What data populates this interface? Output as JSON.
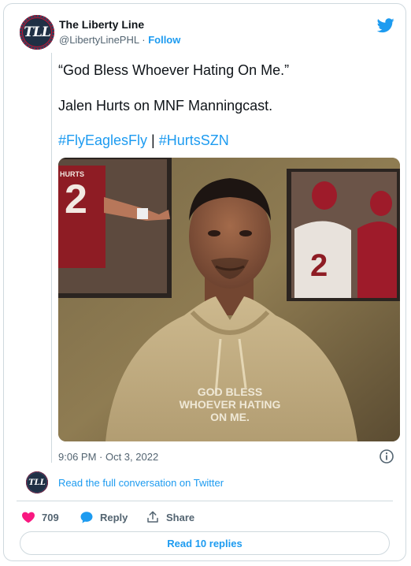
{
  "author": {
    "name": "The Liberty Line",
    "handle": "@LibertyLinePHL",
    "separator": "·",
    "follow_label": "Follow",
    "avatar_text": "TLL",
    "avatar_icon": "liberty-line-logo-icon"
  },
  "tweet": {
    "line1": "“God Bless Whoever Hating On Me.”",
    "line2": "Jalen Hurts on MNF Manningcast.",
    "hashtag1": "#FlyEaglesFly",
    "hashtag_separator": " | ",
    "hashtag2": "#HurtsSZN"
  },
  "media": {
    "hoodie_text": [
      "GOD BLESS",
      "WHOEVER HATING",
      "ON ME."
    ],
    "jersey_number": "2",
    "poster_label": "HURTS"
  },
  "meta": {
    "datetime": "9:06 PM · Oct 3, 2022"
  },
  "conversation": {
    "link_label": "Read the full conversation on Twitter"
  },
  "actions": {
    "like_count": "709",
    "reply_label": "Reply",
    "share_label": "Share",
    "read_replies_label": "Read 10 replies"
  },
  "colors": {
    "accent": "#1d9bf0",
    "like": "#f91880",
    "border": "#cfd9de",
    "muted": "#536471"
  }
}
